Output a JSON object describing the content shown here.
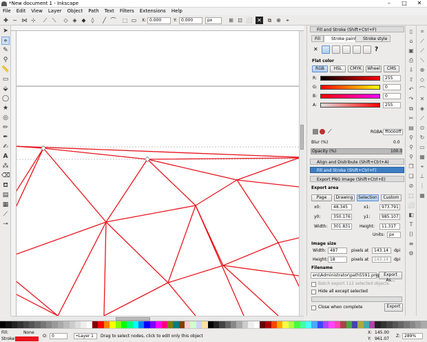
{
  "window": {
    "title": "*New document 1 - Inkscape",
    "buttons": [
      "–",
      "□",
      "✕"
    ]
  },
  "menu": [
    "File",
    "Edit",
    "View",
    "Layer",
    "Object",
    "Path",
    "Text",
    "Filters",
    "Extensions",
    "Help"
  ],
  "controls": {
    "x_value": "0.000",
    "y_value": "0.000",
    "unit": "px"
  },
  "fill_stroke": {
    "title": "Fill and Stroke (Shift+Ctrl+F)",
    "tabs": [
      "Fill",
      "Stroke paint",
      "Stroke style"
    ],
    "paint_type_x": "✕",
    "paint_type_q": "?",
    "flat_color": "Flat color",
    "modes": [
      "RGB",
      "HSL",
      "CMYK",
      "Wheel",
      "CMS"
    ],
    "channels": [
      {
        "label": "R:",
        "value": "255"
      },
      {
        "label": "G:",
        "value": "0"
      },
      {
        "label": "B:",
        "value": "0"
      },
      {
        "label": "A:",
        "value": "255"
      }
    ],
    "rgba_label": "RGBA:",
    "rgba_value": "ff0000ff",
    "blur_label": "Blur (%)",
    "blur_value": "0.0",
    "opacity_label": "Opacity (%)",
    "opacity_value": "100.0"
  },
  "collapsed_panels": [
    "Align and Distribute (Shift+Ctrl+A)",
    "Fill and Stroke (Shift+Ctrl+F)"
  ],
  "export": {
    "title": "Export PNG Image (Shift+Ctrl+E)",
    "area_label": "Export area",
    "area_buttons": [
      "Page",
      "Drawing",
      "Selection",
      "Custom"
    ],
    "x0_label": "x0:",
    "x0": "48.345",
    "x1_label": "x1:",
    "x1": "973.791",
    "y0_label": "y0:",
    "y0": "350.176",
    "y1_label": "y1:",
    "y1": "985.107",
    "width_label": "Width:",
    "width": "301.831",
    "height_label": "Height:",
    "height": "11.317",
    "units_label": "Units:",
    "units": "px",
    "image_size_label": "Image size",
    "img_width_label": "Width:",
    "img_width": "487",
    "dpi_label": "pixels at",
    "dpi": "143.14",
    "dpi_unit": "dpi",
    "img_height_label": "Height:",
    "img_height": "18",
    "dpi2": "143.14",
    "filename_label": "Filename",
    "filename": "ers\\Administrator\\path5591.png",
    "export_as": "Export As...",
    "batch": "Batch export 112 selected objects",
    "hide_all": "Hide all except selected",
    "close_when": "Close when complete",
    "export_btn": "Export"
  },
  "status": {
    "fill_label": "Fill:",
    "fill_value": "None",
    "stroke_label": "Stroke:",
    "stroke_color": "#e8141c",
    "opacity_label": "O:",
    "opacity_value": "0",
    "layer": "•Layer 1",
    "message": "Drag to select nodes, click to edit only this object",
    "x_label": "X:",
    "x_value": "145.00",
    "y_label": "Y:",
    "y_value": "961.07",
    "z_label": "Z:",
    "zoom": "289%"
  },
  "colors": {
    "accent": "#3d7ec4",
    "stroke": "#e8141c"
  }
}
